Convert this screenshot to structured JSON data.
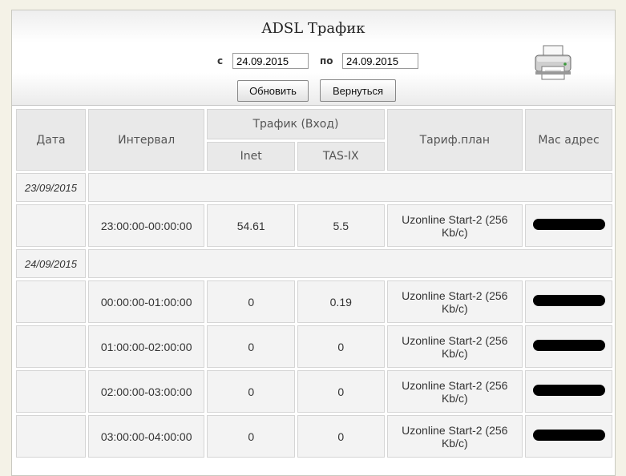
{
  "header": {
    "title": "ADSL Трафик",
    "from_label": "с",
    "from_value": "24.09.2015",
    "to_label": "по",
    "to_value": "24.09.2015",
    "refresh_label": "Обновить",
    "back_label": "Вернуться",
    "print_icon": "printer-icon"
  },
  "table": {
    "col_date": "Дата",
    "col_interval": "Интервал",
    "col_traffic": "Трафик (Вход)",
    "col_inet": "Inet",
    "col_tasix": "TAS-IX",
    "col_tariff": "Тариф.план",
    "col_mac": "Mac адрес",
    "groups": [
      {
        "date": "23/09/2015",
        "rows": [
          {
            "interval": "23:00:00-00:00:00",
            "inet": "54.61",
            "tasix": "5.5",
            "tariff": "Uzonline Start-2 (256 Kb/c)"
          }
        ]
      },
      {
        "date": "24/09/2015",
        "rows": [
          {
            "interval": "00:00:00-01:00:00",
            "inet": "0",
            "tasix": "0.19",
            "tariff": "Uzonline Start-2 (256 Kb/c)"
          },
          {
            "interval": "01:00:00-02:00:00",
            "inet": "0",
            "tasix": "0",
            "tariff": "Uzonline Start-2 (256 Kb/c)"
          },
          {
            "interval": "02:00:00-03:00:00",
            "inet": "0",
            "tasix": "0",
            "tariff": "Uzonline Start-2 (256 Kb/c)"
          },
          {
            "interval": "03:00:00-04:00:00",
            "inet": "0",
            "tasix": "0",
            "tariff": "Uzonline Start-2 (256 Kb/c)"
          }
        ]
      }
    ]
  }
}
